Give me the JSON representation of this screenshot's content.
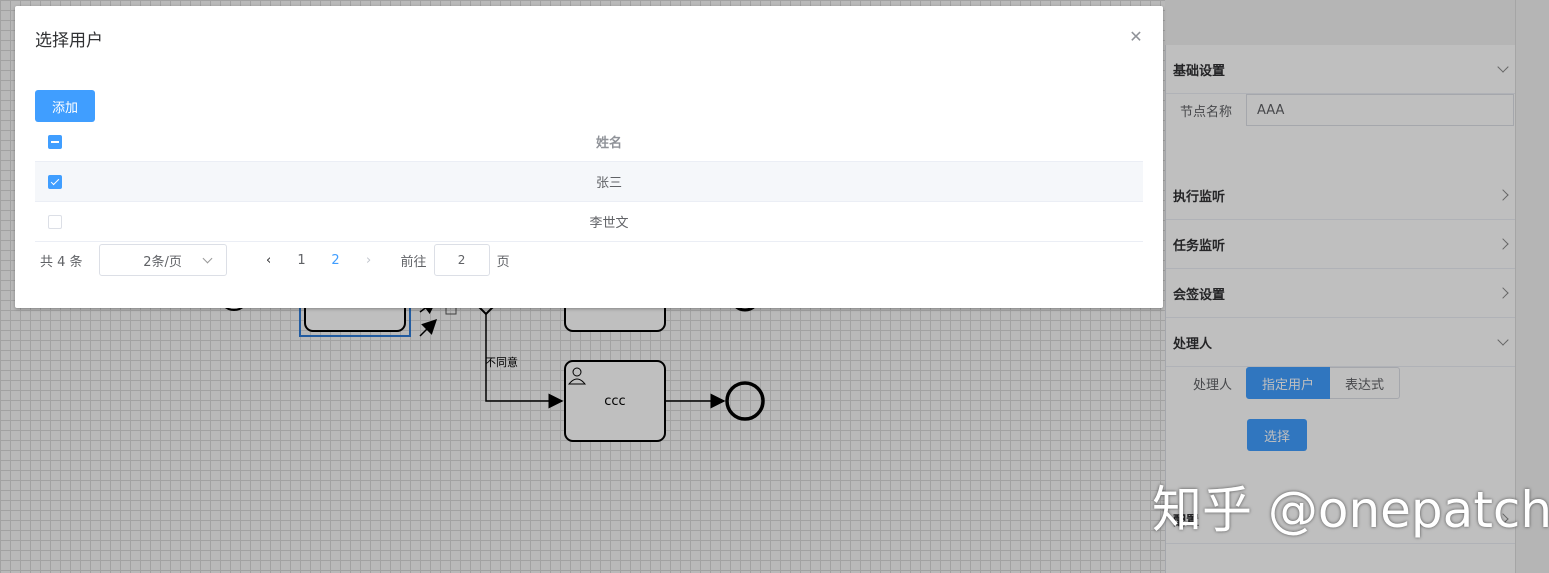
{
  "dialog": {
    "title": "选择用户",
    "add_label": "添加",
    "table": {
      "header": "姓名",
      "rows": [
        {
          "name": "张三",
          "checked": true
        },
        {
          "name": "李世文",
          "checked": false
        }
      ]
    },
    "pagination": {
      "total": "共 4 条",
      "page_size": "2条/页",
      "pages": [
        "1",
        "2"
      ],
      "current_page": "2",
      "goto_label": "前往",
      "goto_value": "2",
      "goto_suffix": "页"
    }
  },
  "canvas": {
    "edge_label": "不同意",
    "task_label": "ccc"
  },
  "panel": {
    "basic_title": "基础设置",
    "node_name_label": "节点名称",
    "node_name_value": "AAA",
    "exec_listener": "执行监听",
    "task_listener": "任务监听",
    "multi_instance": "会签设置",
    "handler_title": "处理人",
    "handler_label": "处理人",
    "handler_options": [
      "指定用户",
      "表达式"
    ],
    "choose_label": "选择",
    "bottom_section": "配置"
  },
  "watermark": "知乎 @onepatch",
  "colors": {
    "primary": "#409eff"
  }
}
